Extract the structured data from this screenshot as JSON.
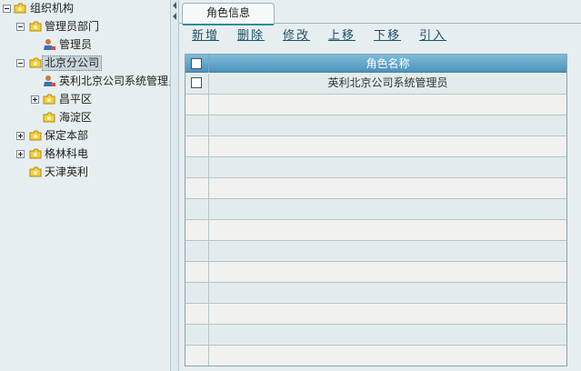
{
  "tree": {
    "items": [
      {
        "label": "组织机构",
        "level": 0,
        "toggle": "minus",
        "icon": "folder-icon"
      },
      {
        "label": "管理员部门",
        "level": 1,
        "toggle": "minus",
        "icon": "folder-icon"
      },
      {
        "label": "管理员",
        "level": 2,
        "toggle": "",
        "icon": "user-icon"
      },
      {
        "label": "北京分公司",
        "level": 1,
        "toggle": "minus",
        "icon": "folder-icon",
        "selected": true
      },
      {
        "label": "英利北京公司系统管理员",
        "level": 2,
        "toggle": "",
        "icon": "user-icon"
      },
      {
        "label": "昌平区",
        "level": 2,
        "toggle": "plus",
        "icon": "folder-icon"
      },
      {
        "label": "海淀区",
        "level": 2,
        "toggle": "",
        "icon": "folder-icon"
      },
      {
        "label": "保定本部",
        "level": 1,
        "toggle": "plus",
        "icon": "folder-icon"
      },
      {
        "label": "格林科电",
        "level": 1,
        "toggle": "plus",
        "icon": "folder-icon"
      },
      {
        "label": "天津英利",
        "level": 1,
        "toggle": "",
        "icon": "folder-icon"
      }
    ]
  },
  "tab": {
    "label": "角色信息"
  },
  "toolbar": {
    "buttons": [
      "新增",
      "删除",
      "修改",
      "上移",
      "下移",
      "引入"
    ]
  },
  "grid": {
    "header": "角色名称",
    "rows": [
      "英利北京公司系统管理员",
      "",
      "",
      "",
      "",
      "",
      "",
      "",
      "",
      "",
      "",
      "",
      "",
      ""
    ]
  },
  "colors": {
    "header_top": "#7fbcd8",
    "header_bottom": "#4b93bd",
    "link": "#1b4f63"
  }
}
